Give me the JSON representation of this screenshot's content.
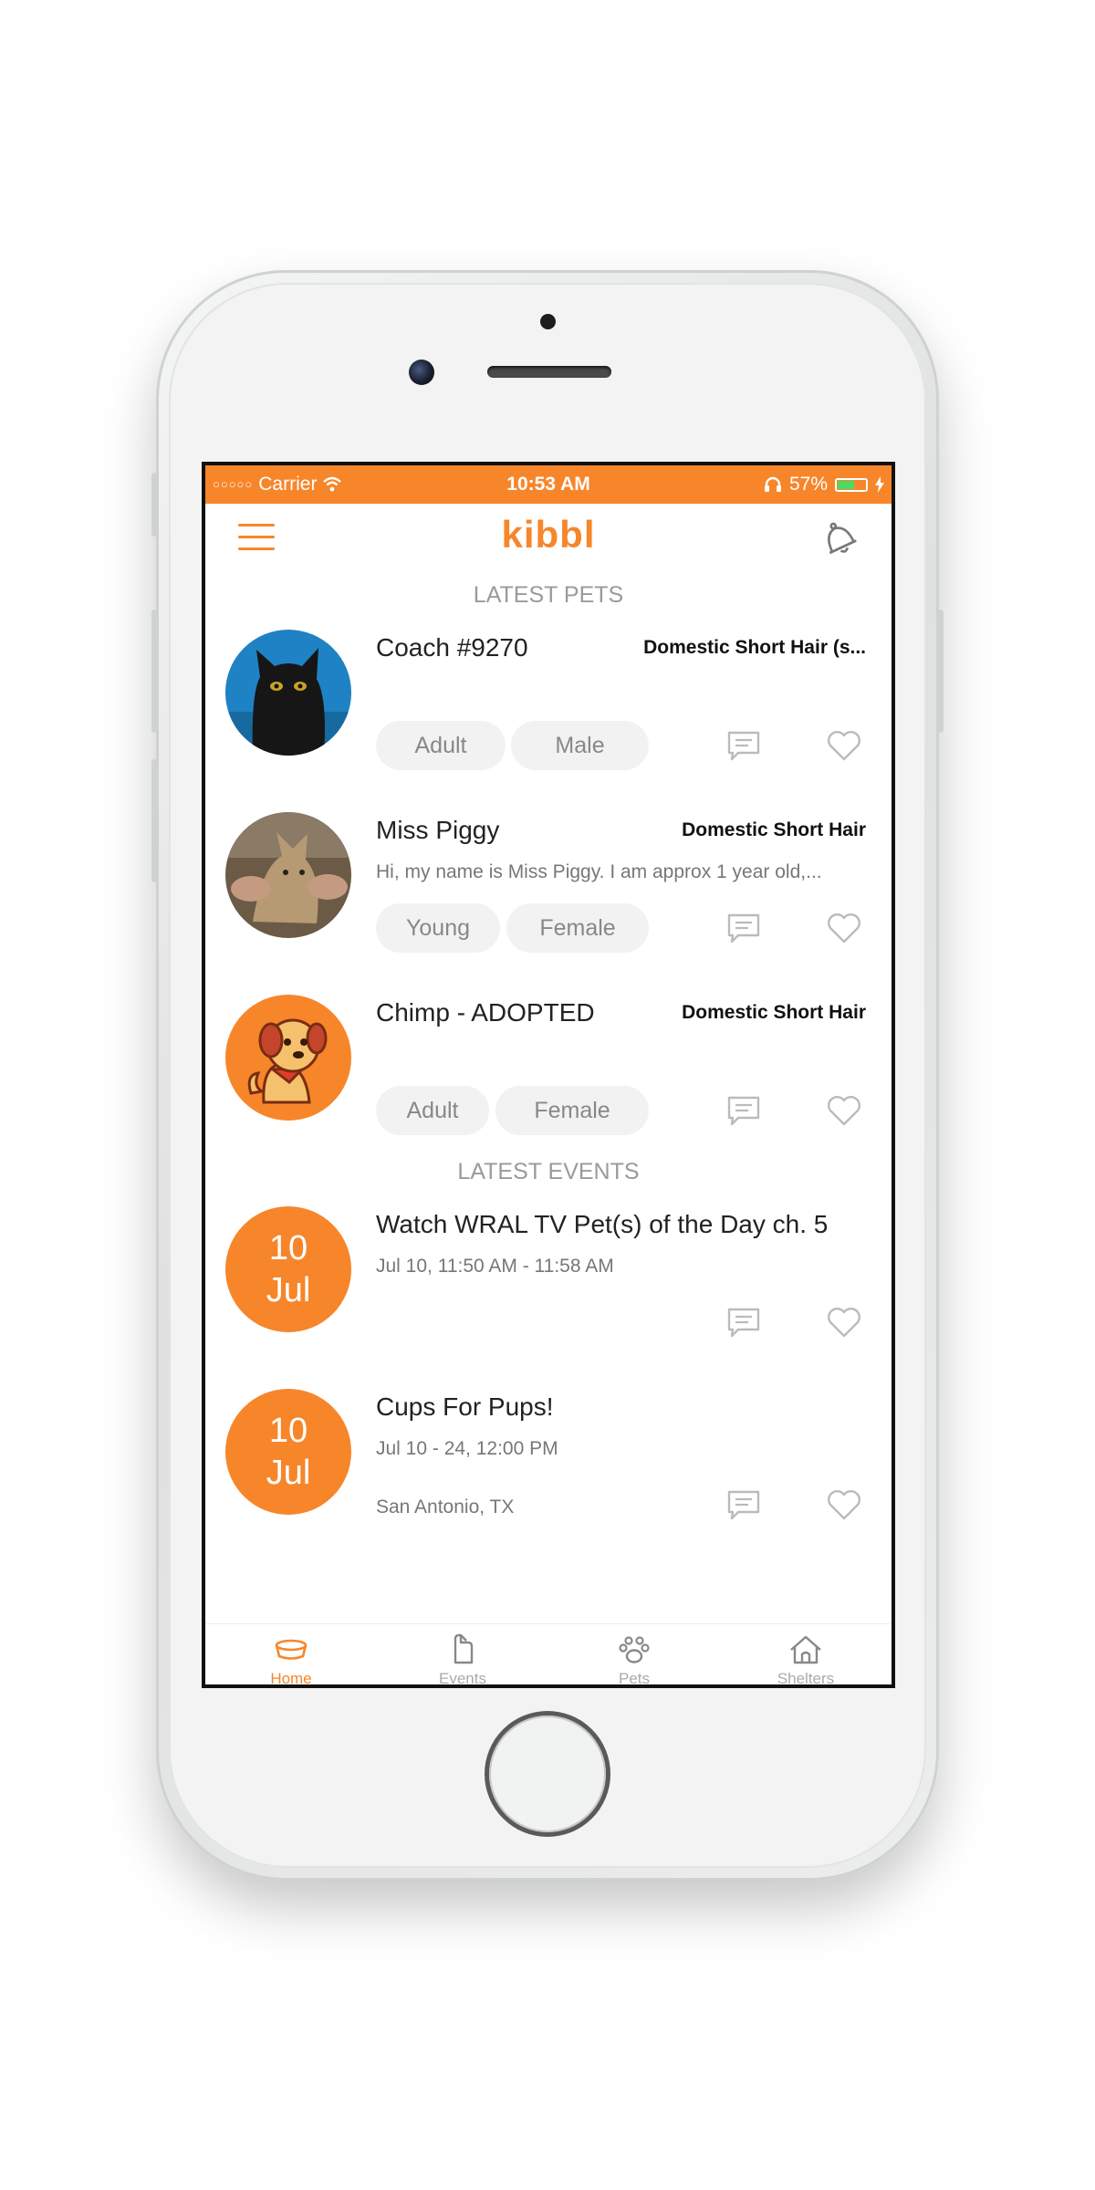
{
  "status_bar": {
    "carrier": "Carrier",
    "time": "10:53 AM",
    "battery": "57%",
    "battery_level": 0.57
  },
  "header": {
    "logo": "kibbl"
  },
  "sections": {
    "pets_title": "LATEST PETS",
    "events_title": "LATEST EVENTS"
  },
  "pets": [
    {
      "name": "Coach #9270",
      "breed": "Domestic Short Hair (s...",
      "description": "",
      "age": "Adult",
      "sex": "Male"
    },
    {
      "name": "Miss Piggy",
      "breed": "Domestic Short Hair",
      "description": "Hi, my name is Miss Piggy. I am approx 1 year old,...",
      "age": "Young",
      "sex": "Female"
    },
    {
      "name": "Chimp - ADOPTED",
      "breed": "Domestic Short Hair",
      "description": "",
      "age": "Adult",
      "sex": "Female"
    }
  ],
  "events": [
    {
      "day": "10",
      "month": "Jul",
      "title": "Watch WRAL TV Pet(s) of the Day ch. 5",
      "time": "Jul 10, 11:50 AM - 11:58 AM",
      "location": ""
    },
    {
      "day": "10",
      "month": "Jul",
      "title": "Cups For Pups!",
      "time": "Jul 10 - 24, 12:00 PM",
      "location": "San Antonio, TX"
    }
  ],
  "tabs": [
    {
      "label": "Home",
      "icon": "bowl-icon"
    },
    {
      "label": "Events",
      "icon": "events-icon"
    },
    {
      "label": "Pets",
      "icon": "paw-icon"
    },
    {
      "label": "Shelters",
      "icon": "house-icon"
    }
  ],
  "colors": {
    "accent": "#f7862a",
    "tag_bg": "#f2f2f2",
    "muted_text": "#9a9a9a"
  }
}
